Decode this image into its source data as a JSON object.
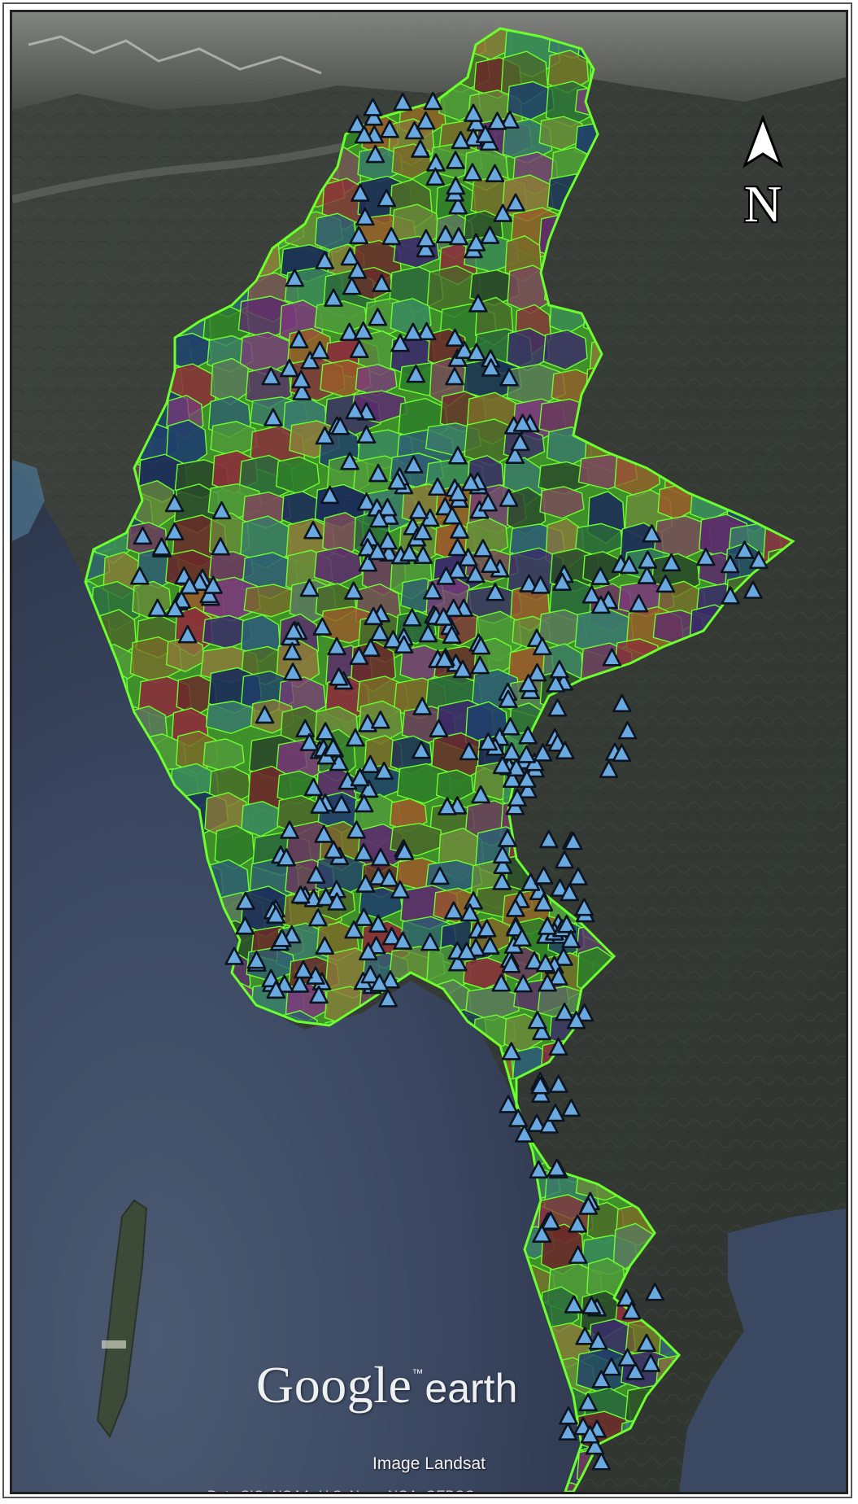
{
  "map": {
    "compass_letter": "N",
    "logo_google": "Google",
    "logo_tm": "™",
    "logo_earth": "earth",
    "attribution": "Image Landsat",
    "credits": "Data SIO, NOAA, U.S. Navy, NGA, GEBCO",
    "colors": {
      "boundary": "#6cff2e",
      "marker_fill": "#6aa8e0",
      "marker_stroke": "#0c1420",
      "sea": "#3c4a5e",
      "land": "#3a3f38"
    },
    "icons": [
      "north-arrow-icon",
      "triangle-marker-icon"
    ]
  }
}
